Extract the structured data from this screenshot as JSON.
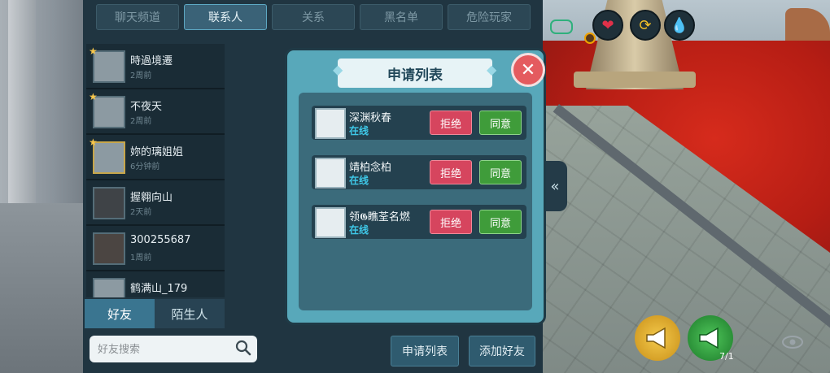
{
  "top_tabs": [
    "聊天频道",
    "联系人",
    "关系",
    "黑名单",
    "危险玩家"
  ],
  "contacts": [
    {
      "name": "時過境遷",
      "time": "2周前"
    },
    {
      "name": "不夜天",
      "time": "2周前"
    },
    {
      "name": "妳的璃姐姐",
      "time": "6分钟前"
    },
    {
      "name": "握翱向山",
      "time": "2天前"
    },
    {
      "name": "300255687",
      "time": "1周前"
    },
    {
      "name": "鹤满山_179",
      "time": ""
    }
  ],
  "bottom_tabs": [
    "好友",
    "陌生人"
  ],
  "search": {
    "placeholder": "好友搜索"
  },
  "actions": {
    "request_list": "申请列表",
    "add_friend": "添加好友"
  },
  "dialog": {
    "title": "申请列表",
    "requests": [
      {
        "name": "深渊秋春",
        "status": "在线",
        "reject": "拒绝",
        "accept": "同意"
      },
      {
        "name": "靖柏念柏",
        "status": "在线",
        "reject": "拒绝",
        "accept": "同意"
      },
      {
        "name": "领𝕲瞧荃名燃",
        "status": "在线",
        "reject": "拒绝",
        "accept": "同意"
      }
    ]
  },
  "counter": "7/1",
  "colors": {
    "accent": "#3fc9e9",
    "reject": "#d6455e",
    "accept": "#3f9c3a"
  }
}
